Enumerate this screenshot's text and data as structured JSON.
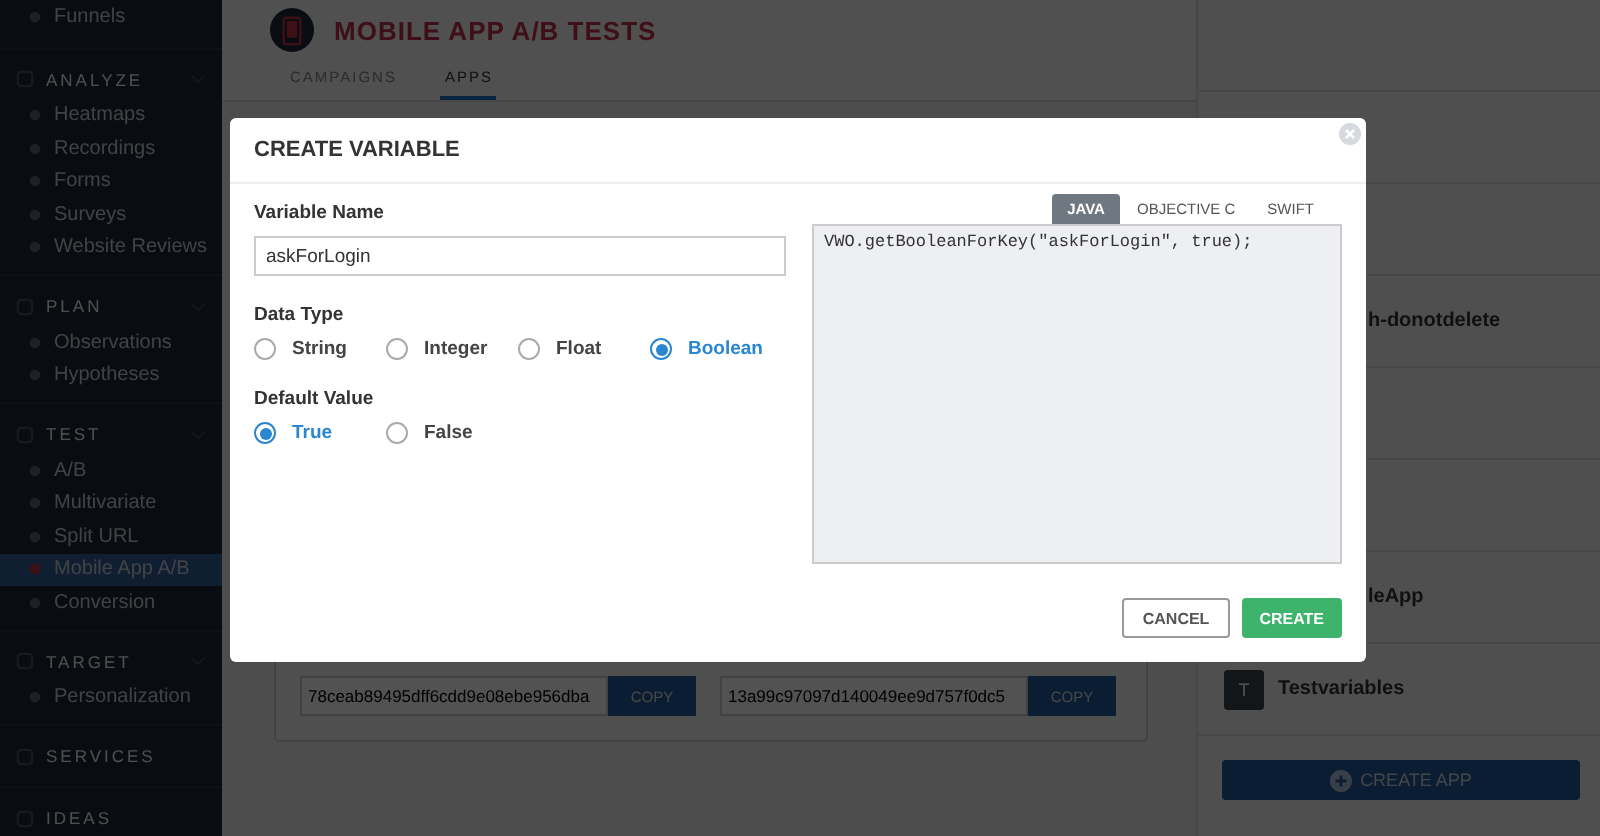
{
  "sidebar": {
    "sections": [
      {
        "items": [
          {
            "label": "Funnels",
            "selected": false
          }
        ]
      },
      {
        "header": "ANALYZE",
        "items": [
          {
            "label": "Heatmaps",
            "selected": false
          },
          {
            "label": "Recordings",
            "selected": false
          },
          {
            "label": "Forms",
            "selected": false
          },
          {
            "label": "Surveys",
            "selected": false
          },
          {
            "label": "Website Reviews",
            "selected": false
          }
        ]
      },
      {
        "header": "PLAN",
        "items": [
          {
            "label": "Observations",
            "selected": false
          },
          {
            "label": "Hypotheses",
            "selected": false
          }
        ]
      },
      {
        "header": "TEST",
        "items": [
          {
            "label": "A/B",
            "selected": false
          },
          {
            "label": "Multivariate",
            "selected": false
          },
          {
            "label": "Split URL",
            "selected": false
          },
          {
            "label": "Mobile App A/B",
            "selected": true
          },
          {
            "label": "Conversion",
            "selected": false
          }
        ]
      },
      {
        "header": "TARGET",
        "items": [
          {
            "label": "Personalization",
            "selected": false
          }
        ]
      },
      {
        "header": "SERVICES"
      },
      {
        "header": "IDEAS"
      }
    ]
  },
  "page": {
    "title": "MOBILE APP A/B TESTS",
    "tabs": [
      {
        "label": "CAMPAIGNS",
        "selected": false
      },
      {
        "label": "APPS",
        "selected": true
      }
    ],
    "keys": [
      {
        "value": "78ceab89495dff6cdd9e08ebe956dba",
        "button": "COPY"
      },
      {
        "value": "13a99c97097d140049ee9d757f0dc5",
        "button": "COPY"
      }
    ]
  },
  "apps_panel": {
    "apps": [
      {
        "label": "h-donotdelete"
      },
      {
        "label": "leApp"
      },
      {
        "label": "Testvariables",
        "avatar": "T"
      }
    ],
    "create_button": "CREATE APP"
  },
  "modal": {
    "title": "CREATE VARIABLE",
    "name_field": {
      "label": "Variable Name",
      "value": "askForLogin"
    },
    "data_type": {
      "label": "Data Type",
      "options": [
        {
          "label": "String",
          "selected": false
        },
        {
          "label": "Integer",
          "selected": false
        },
        {
          "label": "Float",
          "selected": false
        },
        {
          "label": "Boolean",
          "selected": true
        }
      ]
    },
    "default_value": {
      "label": "Default Value",
      "options": [
        {
          "label": "True",
          "selected": true
        },
        {
          "label": "False",
          "selected": false
        }
      ]
    },
    "code_tabs": [
      {
        "label": "JAVA",
        "selected": true
      },
      {
        "label": "OBJECTIVE C",
        "selected": false
      },
      {
        "label": "SWIFT",
        "selected": false
      }
    ],
    "code": "VWO.getBooleanForKey(\"askForLogin\", true);",
    "buttons": [
      {
        "label": "CANCEL",
        "kind": "secondary"
      },
      {
        "label": "CREATE",
        "kind": "primary"
      }
    ]
  }
}
